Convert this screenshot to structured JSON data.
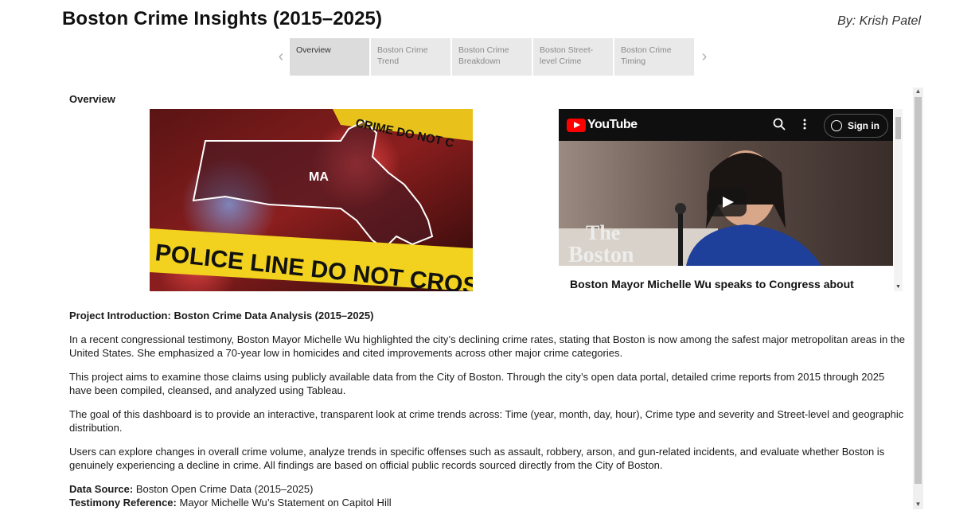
{
  "header": {
    "title": "Boston Crime Insights (2015–2025)",
    "author": "By: Krish Patel"
  },
  "tabs": [
    {
      "label": "Overview",
      "active": true
    },
    {
      "label": "Boston Crime Trend",
      "active": false
    },
    {
      "label": "Boston Crime Breakdown",
      "active": false
    },
    {
      "label": "Boston Street-level Crime",
      "active": false
    },
    {
      "label": "Boston Crime Timing",
      "active": false
    }
  ],
  "nav": {
    "prev_icon": "chevron-left-icon",
    "next_icon": "chevron-right-icon"
  },
  "overview": {
    "section_label": "Overview",
    "hero_image_label": "MA",
    "hero_tape_text": "POLICE LINE DO NOT CROSS",
    "hero_tape_text_top": "CRIME DO NOT C"
  },
  "youtube": {
    "brand": "YouTube",
    "sign_in": "Sign in",
    "video_caption": "Boston Mayor Michelle Wu speaks to Congress about",
    "watermark_line1": "The",
    "watermark_line2": "Boston"
  },
  "intro": {
    "heading": "Project Introduction: Boston Crime Data Analysis (2015–2025)",
    "p1": "In a recent congressional testimony, Boston Mayor Michelle Wu highlighted the city’s declining crime rates, stating that Boston is now among the safest major metropolitan areas in the United States. She emphasized a 70-year low in homicides and cited improvements across other major crime categories.",
    "p2": "This project aims to examine those claims using publicly available data from the City of Boston. Through the city’s open data portal, detailed crime reports from 2015 through 2025 have been compiled, cleansed, and analyzed using Tableau.",
    "p3": "The goal of this dashboard is to provide an interactive, transparent look at crime trends across: Time (year, month, day, hour), Crime type and severity and Street-level and geographic distribution.",
    "p4": "Users can explore changes in overall crime volume, analyze trends in specific offenses such as assault, robbery, arson, and gun-related incidents, and evaluate whether Boston is genuinely experiencing a decline in crime. All findings are based on official public records sourced directly from the City of Boston.",
    "source_label": "Data Source:",
    "source_value": "Boston Open Crime Data (2015–2025)",
    "testimony_label": "Testimony Reference:",
    "testimony_value": "Mayor Michelle Wu’s Statement on Capitol Hill"
  },
  "colors": {
    "accent_red": "#ff0000",
    "tab_active": "#dcdcdc",
    "tab_inactive": "#e9e9e9"
  }
}
